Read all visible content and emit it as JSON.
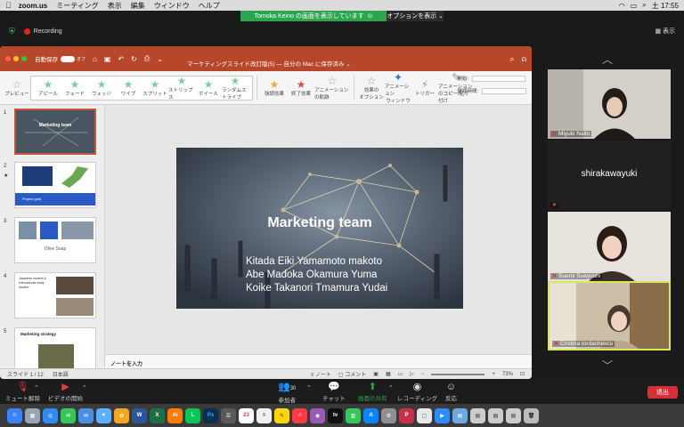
{
  "menubar": {
    "app": "zoom.us",
    "items": [
      "ミーティング",
      "表示",
      "編集",
      "ウィンドウ",
      "ヘルプ"
    ],
    "time": "土 17:55"
  },
  "share_banner": {
    "text": "Tomoka Keino の画面を表示しています",
    "options": "オプションを表示 ⌄"
  },
  "zoom_top": {
    "recording": "Recording",
    "view": "表示"
  },
  "ppt": {
    "autosave": "自動保存",
    "autosave_state": "オフ",
    "doc_title": "マーケティングスライド改訂版(5) — 自分の Mac に保存済み ⌄",
    "ribbon": {
      "preview": "プレビュー",
      "effects": [
        "アピール",
        "フェード",
        "ウェッジ",
        "ワイプ",
        "スプリット",
        "ストリップス",
        "ホイール",
        "ランダムストライプ"
      ],
      "effect_options": "効果のオプション",
      "effect_options_sub": "効果のオプション",
      "effect_options_label": "効果のオプション",
      "apply1": "強調効果",
      "apply2": "終了効果",
      "anim_options": "アニメーションの軌跡",
      "order": "効果の",
      "order2": "オプション",
      "anim_window": "アニメーション",
      "anim_window2": "ウィンドウ",
      "trigger": "トリガー",
      "copy_anim": "アニメーションのコピー/貼り付け",
      "start": "開始:",
      "duration": "継続時間:"
    },
    "slide_count_label": "スライド 1 / 12",
    "language": "日本語",
    "notes_placeholder": "ノートを入力",
    "note_btn": "ノート",
    "comment_btn": "コメント",
    "zoom_level": "73%"
  },
  "slide": {
    "title": "Marketing team",
    "names": [
      "Kitada Eiki   Yamamoto makoto",
      "Abe Madoka   Okamura Yuma",
      "Koike  Takanori   Tmamura Yudai"
    ]
  },
  "thumbnails": [
    {
      "num": "1",
      "label": "Marketing team"
    },
    {
      "num": "2",
      "label": "Project goal"
    },
    {
      "num": "3",
      "label": "Olive Soap"
    },
    {
      "num": "4",
      "label": "Japanese student & International study student"
    },
    {
      "num": "5",
      "label": "Marketing strategy"
    }
  ],
  "participants": [
    {
      "name": "Miyuki Naito"
    },
    {
      "name": "shirakawayuki"
    },
    {
      "name": "Suemi Sueyoshi"
    },
    {
      "name": "Cristina Iordachescu"
    }
  ],
  "zoom_bar": {
    "mute": "ミュート解除",
    "video": "ビデオの開始",
    "participants": "参加者",
    "participant_count": "30",
    "chat": "チャット",
    "share": "画面の共有",
    "record": "レコーディング",
    "reactions": "反応",
    "end": "退出"
  },
  "colors": {
    "ppt_red": "#b7472a",
    "zoom_green": "#2da44e",
    "end_red": "#d3303a",
    "active_border": "#d8e85a"
  }
}
